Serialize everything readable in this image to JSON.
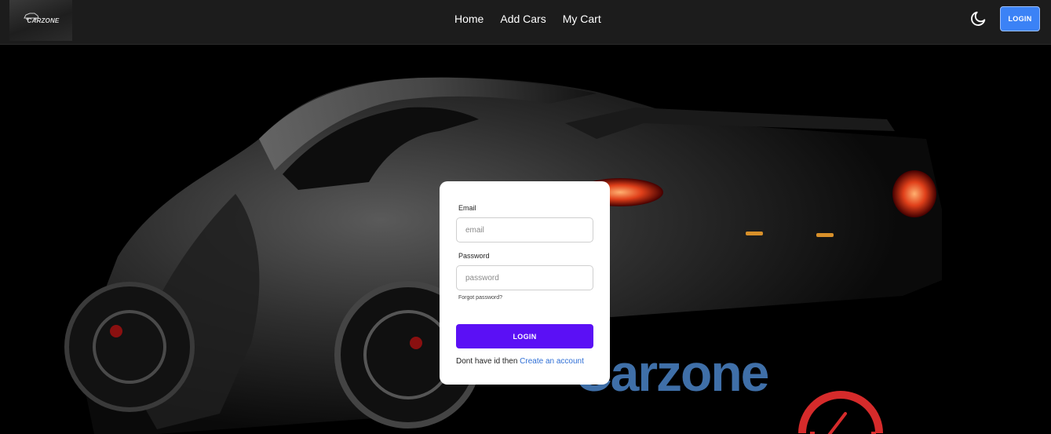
{
  "nav": {
    "logo_text": "CARZONE",
    "links": [
      "Home",
      "Add Cars",
      "My Cart"
    ],
    "theme_icon": "moon-icon",
    "login_label": "LOGIN"
  },
  "hero": {
    "brand_text": "Carzone"
  },
  "login_form": {
    "email_label": "Email",
    "email_placeholder": "email",
    "password_label": "Password",
    "password_placeholder": "password",
    "forgot_text": "Forgot password?",
    "submit_label": "LOGIN",
    "signup_prompt": "Dont have id then ",
    "signup_link": "Create an account"
  },
  "colors": {
    "nav_bg": "#1c1c1c",
    "nav_login_bg": "#3b82f6",
    "submit_bg": "#5b10f5",
    "link": "#2f6fd6",
    "brand_blue": "#3f6fa8",
    "brand_red": "#d62b2b"
  }
}
